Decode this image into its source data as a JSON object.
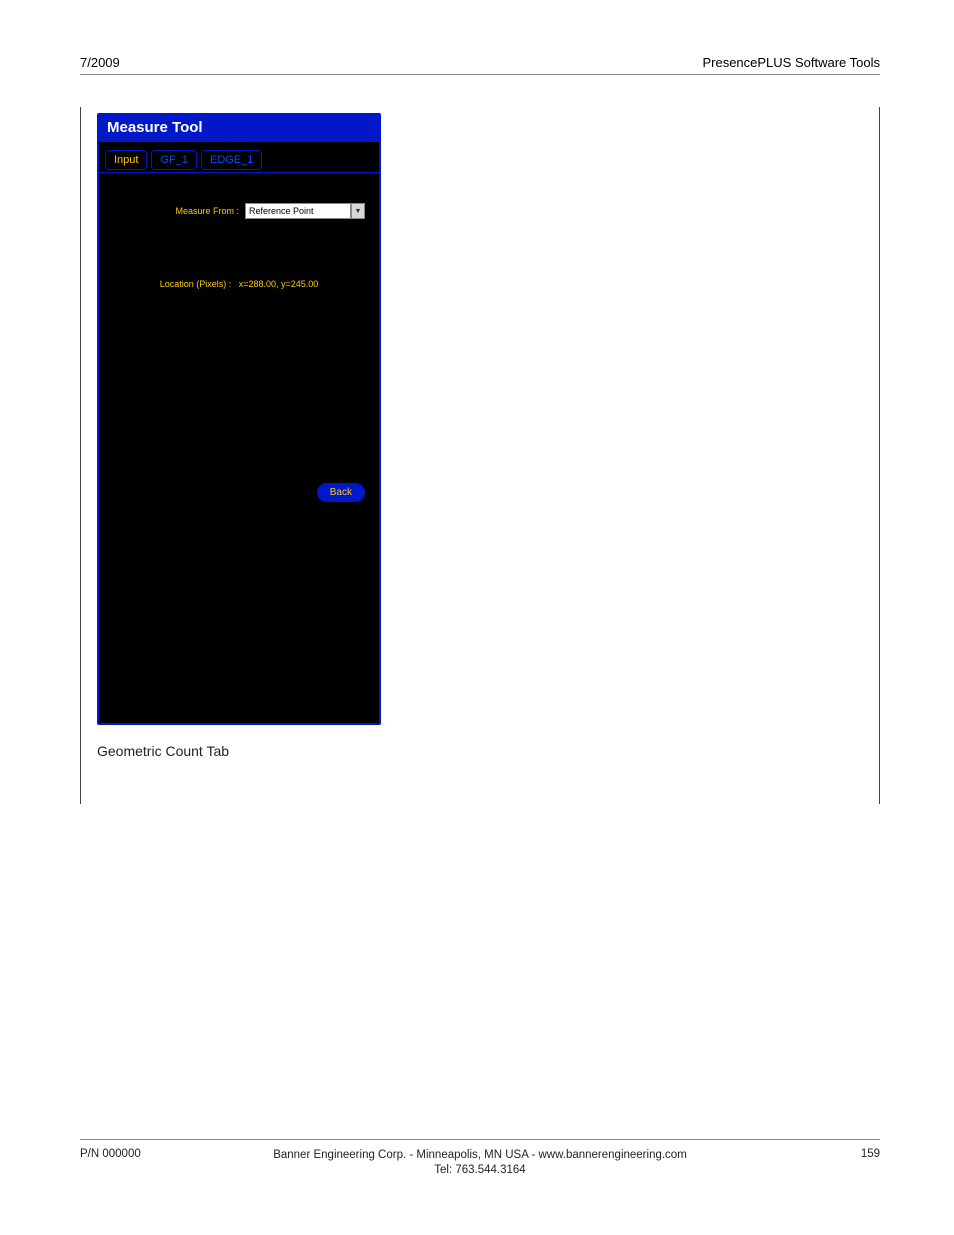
{
  "header": {
    "left": "7/2009",
    "right": "PresencePLUS Software Tools"
  },
  "tool": {
    "title": "Measure Tool",
    "tabs": {
      "input": "Input",
      "gf1": "GF_1",
      "edge1": "EDGE_1"
    },
    "measure_from_label": "Measure From :",
    "measure_from_value": "Reference Point",
    "location_label": "Location (Pixels) :",
    "location_value": "x=288.00, y=245.00",
    "back": "Back"
  },
  "caption": "Geometric Count Tab",
  "footer": {
    "pn": "P/N 000000",
    "line1": "Banner Engineering Corp. - Minneapolis, MN USA - www.bannerengineering.com",
    "line2": "Tel: 763.544.3164",
    "page": "159"
  }
}
